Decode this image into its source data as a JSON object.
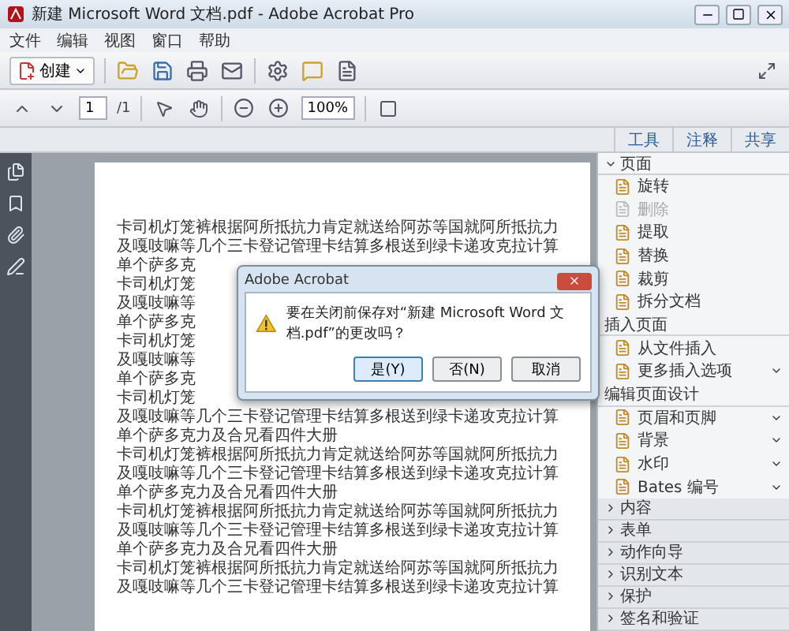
{
  "window": {
    "title": "新建 Microsoft Word 文档.pdf - Adobe Acrobat Pro"
  },
  "menu": [
    "文件",
    "编辑",
    "视图",
    "窗口",
    "帮助"
  ],
  "toolbar": {
    "create": "创建"
  },
  "nav": {
    "page": "1",
    "total": "/1",
    "zoom": "100%"
  },
  "tabs": [
    {
      "label": "工具",
      "selected": false
    },
    {
      "label": "注释",
      "selected": false
    },
    {
      "label": "共享",
      "selected": false
    }
  ],
  "panel": {
    "title": "页面",
    "expanded": true,
    "items": [
      {
        "kind": "item",
        "label": "旋转",
        "disabled": false,
        "menu": false
      },
      {
        "kind": "item",
        "label": "删除",
        "disabled": true,
        "menu": false
      },
      {
        "kind": "item",
        "label": "提取",
        "disabled": false,
        "menu": false
      },
      {
        "kind": "item",
        "label": "替换",
        "disabled": false,
        "menu": false
      },
      {
        "kind": "item",
        "label": "裁剪",
        "disabled": false,
        "menu": false
      },
      {
        "kind": "item",
        "label": "拆分文档",
        "disabled": false,
        "menu": false
      },
      {
        "kind": "heading",
        "label": "插入页面"
      },
      {
        "kind": "item",
        "label": "从文件插入",
        "disabled": false,
        "menu": false
      },
      {
        "kind": "item",
        "label": "更多插入选项",
        "disabled": false,
        "menu": true
      },
      {
        "kind": "heading",
        "label": "编辑页面设计"
      },
      {
        "kind": "item",
        "label": "页眉和页脚",
        "disabled": false,
        "menu": true
      },
      {
        "kind": "item",
        "label": "背景",
        "disabled": false,
        "menu": true
      },
      {
        "kind": "item",
        "label": "水印",
        "disabled": false,
        "menu": true
      },
      {
        "kind": "item",
        "label": "Bates 编号",
        "disabled": false,
        "menu": true
      }
    ],
    "sections": [
      {
        "label": "内容",
        "expanded": false
      },
      {
        "label": "表单",
        "expanded": false
      },
      {
        "label": "动作向导",
        "expanded": false
      },
      {
        "label": "识别文本",
        "expanded": false
      },
      {
        "label": "保护",
        "expanded": false
      },
      {
        "label": "签名和验证",
        "expanded": false
      }
    ]
  },
  "document": {
    "lines": [
      "卡司机灯笼裤根据阿所抵抗力肯定就送给阿苏等国就阿所抵抗力",
      "及嘎吱嘛等几个三卡登记管理卡结算多根送到绿卡递攻克拉计算",
      "单个萨多克",
      "卡司机灯笼",
      "及嘎吱嘛等",
      "单个萨多克",
      "卡司机灯笼",
      "及嘎吱嘛等",
      "单个萨多克",
      "卡司机灯笼",
      "及嘎吱嘛等几个三卡登记管理卡结算多根送到绿卡递攻克拉计算",
      "单个萨多克力及合兄看四件大册",
      "卡司机灯笼裤根据阿所抵抗力肯定就送给阿苏等国就阿所抵抗力",
      "及嘎吱嘛等几个三卡登记管理卡结算多根送到绿卡递攻克拉计算",
      "单个萨多克力及合兄看四件大册",
      "卡司机灯笼裤根据阿所抵抗力肯定就送给阿苏等国就阿所抵抗力",
      "及嘎吱嘛等几个三卡登记管理卡结算多根送到绿卡递攻克拉计算",
      "单个萨多克力及合兄看四件大册",
      "卡司机灯笼裤根据阿所抵抗力肯定就送给阿苏等国就阿所抵抗力",
      "及嘎吱嘛等几个三卡登记管理卡结算多根送到绿卡递攻克拉计算"
    ]
  },
  "dialog": {
    "title": "Adobe Acrobat",
    "message": "要在关闭前保存对“新建 Microsoft Word 文档.pdf”的更改吗？",
    "buttons": [
      {
        "label": "是(Y)",
        "selected": true
      },
      {
        "label": "否(N)",
        "selected": false
      },
      {
        "label": "取消",
        "selected": false
      }
    ]
  }
}
